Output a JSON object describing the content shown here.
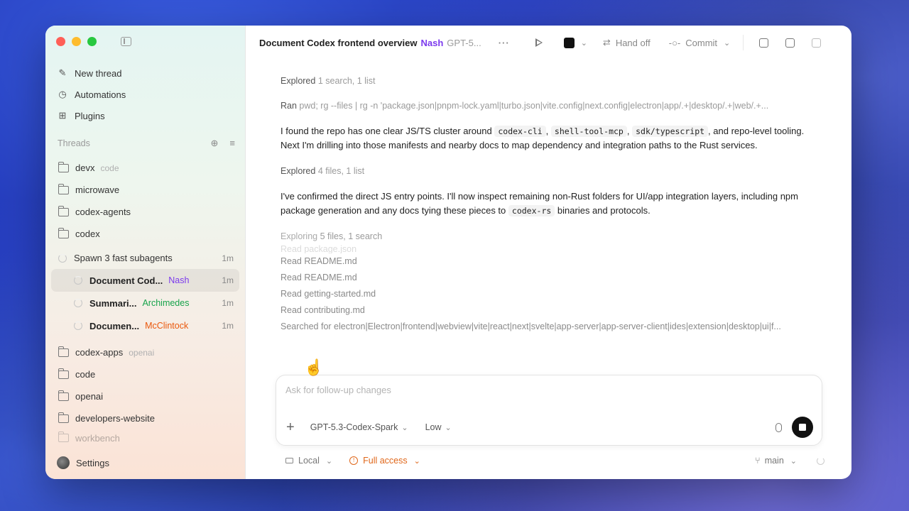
{
  "colors": {
    "accent_orange": "#e0671a",
    "agent_purple": "#7c3aed",
    "agent_green": "#16a34a",
    "agent_orange": "#ea580c"
  },
  "sidebar": {
    "nav": [
      {
        "label": "New thread",
        "icon": "new-thread-icon"
      },
      {
        "label": "Automations",
        "icon": "clock-icon"
      },
      {
        "label": "Plugins",
        "icon": "grid-icon"
      }
    ],
    "threads_heading": "Threads",
    "threads": [
      {
        "label": "devx",
        "sub": "code"
      },
      {
        "label": "microwave",
        "sub": ""
      },
      {
        "label": "codex-agents",
        "sub": ""
      },
      {
        "label": "codex",
        "sub": ""
      }
    ],
    "spawn": {
      "label": "Spawn 3 fast subagents",
      "time": "1m"
    },
    "subagents": [
      {
        "title": "Document Cod...",
        "agent": "Nash",
        "time": "1m"
      },
      {
        "title": "Summari...",
        "agent": "Archimedes",
        "time": "1m"
      },
      {
        "title": "Documen...",
        "agent": "McClintock",
        "time": "1m"
      }
    ],
    "more_threads": [
      {
        "label": "codex-apps",
        "sub": "openai"
      },
      {
        "label": "code",
        "sub": ""
      },
      {
        "label": "openai",
        "sub": ""
      },
      {
        "label": "developers-website",
        "sub": ""
      },
      {
        "label": "workbench",
        "sub": ""
      }
    ],
    "settings": "Settings"
  },
  "topbar": {
    "title": "Document Codex frontend overview",
    "agent": "Nash",
    "model": "GPT-5...",
    "more": "···",
    "handoff": "Hand off",
    "commit": "Commit"
  },
  "content": {
    "explored1_label": "Explored",
    "explored1_detail": "1 search, 1 list",
    "ran_label": "Ran",
    "ran_detail": "pwd; rg --files | rg -n 'package.json|pnpm-lock.yaml|turbo.json|vite.config|next.config|electron|app/.+|desktop/.+|web/.+...",
    "para1": {
      "pre": "I found the repo has one clear JS/TS cluster around",
      "code1": "codex-cli",
      "sep1": ",",
      "code2": "shell-tool-mcp",
      "sep2": ",",
      "code3": "sdk/typescript",
      "post": ", and repo-level tooling. Next I'm drilling into those manifests and nearby docs to map dependency and integration paths to the Rust services."
    },
    "explored2_label": "Explored",
    "explored2_detail": "4 files, 1 list",
    "para2": {
      "pre": "I've confirmed the direct JS entry points. I'll now inspect remaining non-Rust folders for UI/app integration layers, including npm package generation and any docs tying these pieces to",
      "code": "codex-rs",
      "post": "binaries and protocols."
    },
    "exploring_label": "Exploring",
    "exploring_detail": "5 files, 1 search",
    "reads": [
      "Read package.json",
      "Read README.md",
      "Read README.md",
      "Read getting-started.md",
      "Read contributing.md",
      "Searched for electron|Electron|frontend|webview|vite|react|next|svelte|app-server|app-server-client|ides|extension|desktop|ui|f..."
    ]
  },
  "composer": {
    "placeholder": "Ask for follow-up changes",
    "model": "GPT-5.3-Codex-Spark",
    "effort": "Low"
  },
  "footer": {
    "env": "Local",
    "access": "Full access",
    "branch": "main"
  }
}
